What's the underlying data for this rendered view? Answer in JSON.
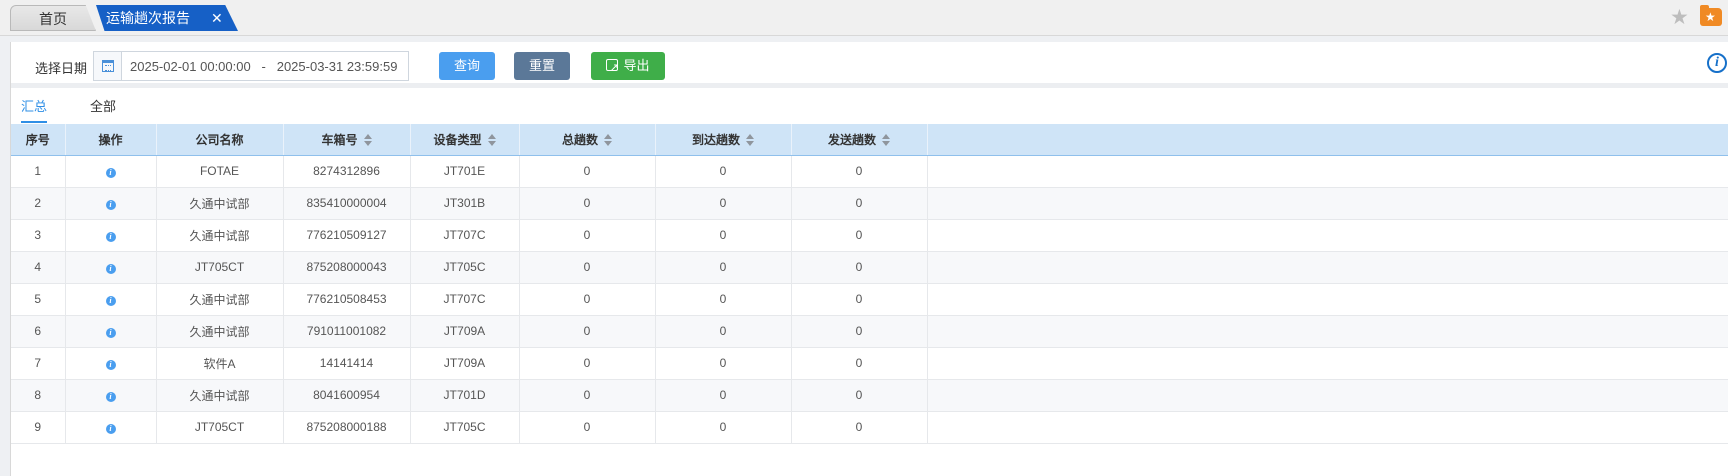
{
  "tabs": {
    "home": "首页",
    "active": "运输趟次报告",
    "close": "✕"
  },
  "toolbar": {
    "date_label": "选择日期",
    "date_range": "2025-02-01 00:00:00   -   2025-03-31 23:59:59",
    "query": "查询",
    "reset": "重置",
    "export": "导出"
  },
  "subtabs": {
    "summary": "汇总",
    "all": "全部"
  },
  "table": {
    "columns": [
      "序号",
      "操作",
      "公司名称",
      "车箱号",
      "设备类型",
      "总趟数",
      "到达趟数",
      "发送趟数"
    ],
    "rows": [
      {
        "no": "1",
        "company": "FOTAE",
        "car": "8274312896",
        "device": "JT701E",
        "total": "0",
        "arrive": "0",
        "send": "0"
      },
      {
        "no": "2",
        "company": "久通中试部",
        "car": "835410000004",
        "device": "JT301B",
        "total": "0",
        "arrive": "0",
        "send": "0"
      },
      {
        "no": "3",
        "company": "久通中试部",
        "car": "776210509127",
        "device": "JT707C",
        "total": "0",
        "arrive": "0",
        "send": "0"
      },
      {
        "no": "4",
        "company": "JT705CT",
        "car": "875208000043",
        "device": "JT705C",
        "total": "0",
        "arrive": "0",
        "send": "0"
      },
      {
        "no": "5",
        "company": "久通中试部",
        "car": "776210508453",
        "device": "JT707C",
        "total": "0",
        "arrive": "0",
        "send": "0"
      },
      {
        "no": "6",
        "company": "久通中试部",
        "car": "791011001082",
        "device": "JT709A",
        "total": "0",
        "arrive": "0",
        "send": "0"
      },
      {
        "no": "7",
        "company": "软件A",
        "car": "14141414",
        "device": "JT709A",
        "total": "0",
        "arrive": "0",
        "send": "0"
      },
      {
        "no": "8",
        "company": "久通中试部",
        "car": "8041600954",
        "device": "JT701D",
        "total": "0",
        "arrive": "0",
        "send": "0"
      },
      {
        "no": "9",
        "company": "JT705CT",
        "car": "875208000188",
        "device": "JT705C",
        "total": "0",
        "arrive": "0",
        "send": "0"
      }
    ]
  }
}
